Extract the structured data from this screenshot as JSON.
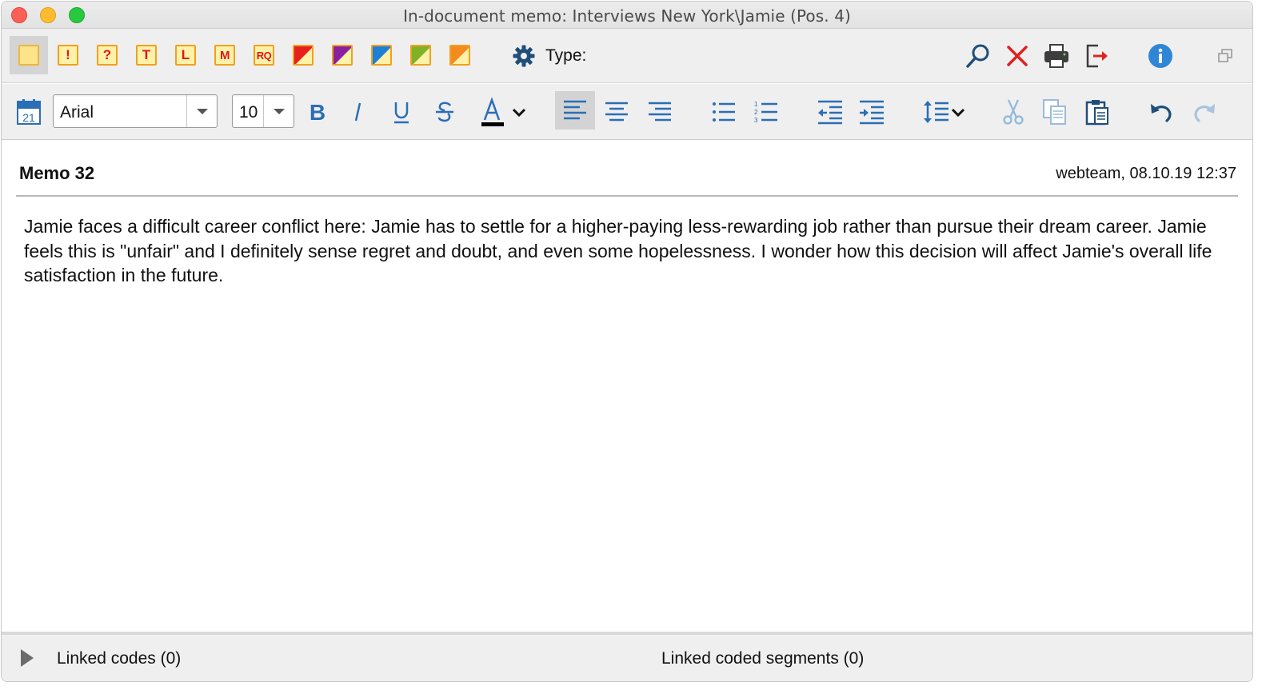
{
  "window": {
    "title": "In-document memo: Interviews New York\\Jamie (Pos. 4)"
  },
  "toolbar1": {
    "memo_types": [
      {
        "name": "memo-type-standard",
        "glyph": ""
      },
      {
        "name": "memo-type-important",
        "glyph": "!"
      },
      {
        "name": "memo-type-question",
        "glyph": "?"
      },
      {
        "name": "memo-type-theory",
        "glyph": "T"
      },
      {
        "name": "memo-type-literature",
        "glyph": "L"
      },
      {
        "name": "memo-type-method",
        "glyph": "M"
      },
      {
        "name": "memo-type-research-question",
        "glyph": "RQ"
      },
      {
        "name": "memo-type-red",
        "color": "#e8201c"
      },
      {
        "name": "memo-type-purple",
        "color": "#8a1fa0"
      },
      {
        "name": "memo-type-blue",
        "color": "#1e7fd6"
      },
      {
        "name": "memo-type-green",
        "color": "#7fb224"
      },
      {
        "name": "memo-type-orange",
        "color": "#f28c1e"
      }
    ],
    "type_label": "Type:",
    "icons": [
      "search-icon",
      "delete-icon",
      "print-icon",
      "export-icon",
      "info-icon",
      "restore-window-icon"
    ]
  },
  "toolbar2": {
    "font_family": "Arial",
    "font_size": "10",
    "icons": [
      "calendar-icon",
      "bold-icon",
      "italic-icon",
      "underline-icon",
      "strikethrough-icon",
      "font-color-icon",
      "align-left-icon",
      "align-center-icon",
      "align-right-icon",
      "bullet-list-icon",
      "numbered-list-icon",
      "outdent-icon",
      "indent-icon",
      "line-spacing-icon",
      "cut-icon",
      "copy-icon",
      "paste-icon",
      "undo-icon",
      "redo-icon"
    ],
    "calendar_day": "21",
    "accent_color": "#2a6eb5"
  },
  "memo": {
    "title": "Memo 32",
    "meta": "webteam, 08.10.19 12:37",
    "body": "Jamie faces a difficult career conflict here: Jamie has to settle for a higher-paying less-rewarding job rather than pursue their dream career. Jamie feels this is \"unfair\" and I definitely sense regret and doubt, and even some hopelessness. I wonder how this decision will affect Jamie's overall life satisfaction in the future."
  },
  "footer": {
    "linked_codes": "Linked codes (0)",
    "linked_segments": "Linked coded segments (0)"
  }
}
